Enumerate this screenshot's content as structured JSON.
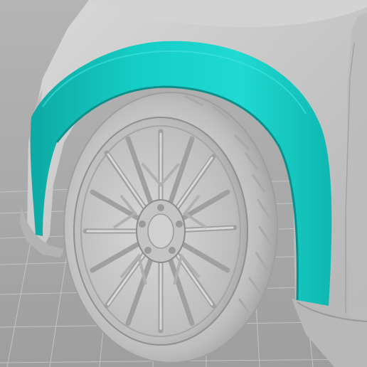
{
  "viewport": {
    "name": "3d-scan-viewport",
    "background_color": "#a9a9a9",
    "grid_color": "#c9c9c9",
    "model_color": "#c7c7c7",
    "highlight_color": "#11c9c2",
    "highlighted_part": "wheel-arch-flare"
  }
}
